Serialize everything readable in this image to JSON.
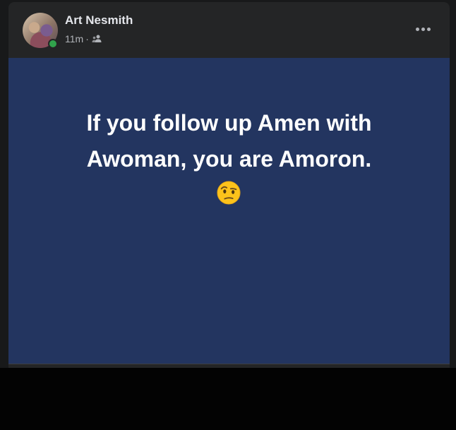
{
  "post": {
    "author": "Art Nesmith",
    "time": "11m",
    "separator": "·",
    "audience_icon": "friends-icon",
    "more_icon": "more-options-icon",
    "text_line1": "If you follow up Amen with",
    "text_line2": "Awoman, you are Amoron.",
    "emoji": "face-with-raised-eyebrow",
    "background_color": "#233560",
    "online_status_color": "#31a24c"
  }
}
